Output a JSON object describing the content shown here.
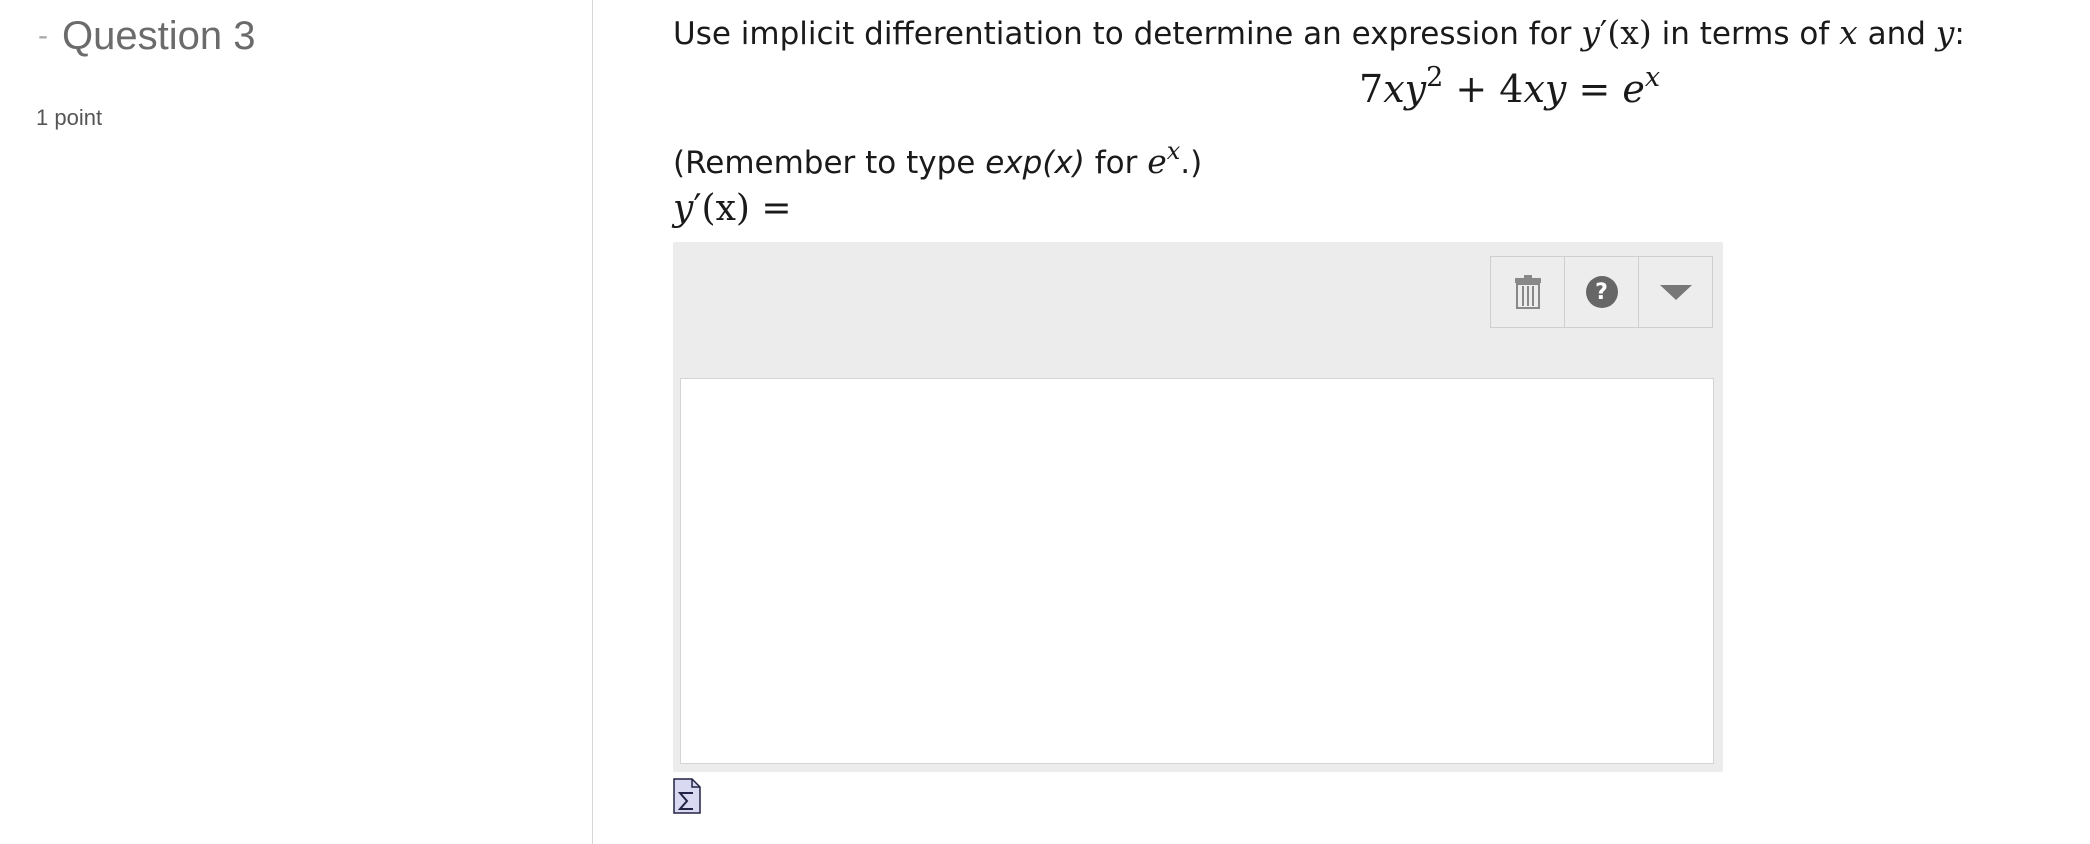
{
  "question": {
    "collapse_symbol": "-",
    "title": "Question 3",
    "points": "1 point"
  },
  "prompt": {
    "text_before": "Use implicit differentiation to determine an expression for ",
    "text_middle1": " in terms of ",
    "var_x": "x",
    "text_middle2": " and ",
    "var_y": "y",
    "text_end": ":"
  },
  "equation": {
    "term1_coeff": "7",
    "term1_var1": "x",
    "term1_var2": "y",
    "term1_exp": "2",
    "plus": " + ",
    "term2_coeff": "4",
    "term2_vars": "xy",
    "equals": " = ",
    "rhs_base": "e",
    "rhs_exp": "x"
  },
  "remember": {
    "before": "(Remember to type ",
    "code": "exp(x)",
    "middle": " for ",
    "base": "e",
    "exp": "x",
    "after": ".)"
  },
  "answer": {
    "label_fn": "y",
    "label_prime": "′",
    "label_arg": "(x)",
    "label_eq": " =",
    "value": ""
  },
  "toolbar": {
    "delete_icon": "trash-icon",
    "help_icon": "help-icon",
    "help_symbol": "?",
    "dropdown_icon": "chevron-down-icon"
  }
}
